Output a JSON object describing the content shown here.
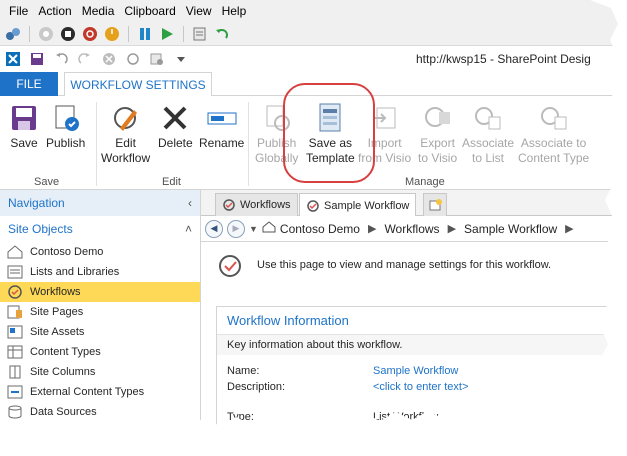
{
  "menu": [
    "File",
    "Action",
    "Media",
    "Clipboard",
    "View",
    "Help"
  ],
  "url": "http://kwsp15 - SharePoint Desig",
  "ribbon_tabs": {
    "file": "FILE",
    "workflow_settings": "WORKFLOW SETTINGS"
  },
  "ribbon": {
    "save": "Save",
    "publish": "Publish",
    "edit_workflow_1": "Edit",
    "edit_workflow_2": "Workflow",
    "delete": "Delete",
    "rename": "Rename",
    "publish_globally_1": "Publish",
    "publish_globally_2": "Globally",
    "save_template_1": "Save as",
    "save_template_2": "Template",
    "import_visio_1": "Import",
    "import_visio_2": "from Visio",
    "export_visio_1": "Export",
    "export_visio_2": "to Visio",
    "assoc_list_1": "Associate",
    "assoc_list_2": "to List",
    "assoc_ct_1": "Associate to",
    "assoc_ct_2": "Content Type",
    "group_save": "Save",
    "group_edit": "Edit",
    "group_manage": "Manage"
  },
  "nav": {
    "header": "Navigation",
    "site_objects": "Site Objects",
    "items": [
      "Contoso Demo",
      "Lists and Libraries",
      "Workflows",
      "Site Pages",
      "Site Assets",
      "Content Types",
      "Site Columns",
      "External Content Types",
      "Data Sources"
    ]
  },
  "doc_tabs": {
    "workflows": "Workflows",
    "sample": "Sample Workflow"
  },
  "breadcrumb": [
    "Contoso Demo",
    "Workflows",
    "Sample Workflow"
  ],
  "intro_text": "Use this page to view and manage settings for this workflow.",
  "info": {
    "title": "Workflow Information",
    "desc": "Key information about this workflow.",
    "name_label": "Name:",
    "name_value": "Sample Workflow",
    "description_label": "Description:",
    "description_value": "<click to enter text>",
    "type_label": "Type:",
    "type_value": "List Workflow"
  }
}
